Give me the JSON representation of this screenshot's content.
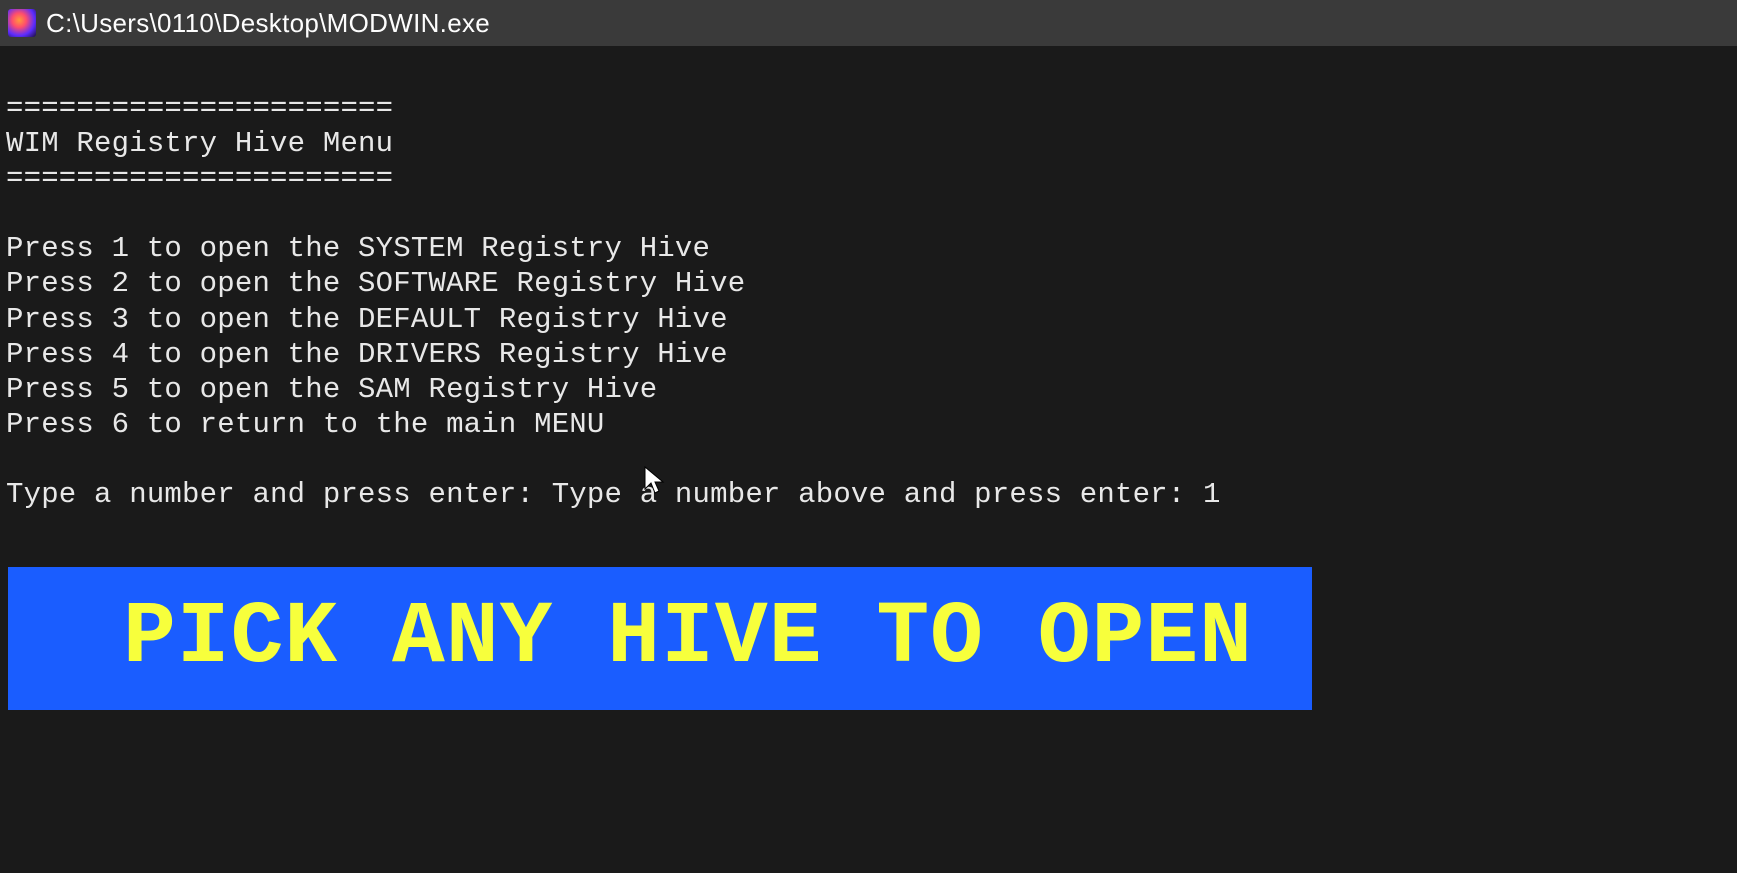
{
  "titlebar": {
    "path": "C:\\Users\\0110\\Desktop\\MODWIN.exe"
  },
  "terminal": {
    "divider_top": "======================",
    "heading": "WIM Registry Hive Menu",
    "divider_bottom": "======================",
    "options": [
      "Press 1 to open the SYSTEM Registry Hive",
      "Press 2 to open the SOFTWARE Registry Hive",
      "Press 3 to open the DEFAULT Registry Hive",
      "Press 4 to open the DRIVERS Registry Hive",
      "Press 5 to open the SAM Registry Hive",
      "Press 6 to return to the main MENU"
    ],
    "prompt_prefix": "Type a number and press enter: Type a number above and press enter: ",
    "input_value": "1"
  },
  "banner": {
    "text": "PICK ANY HIVE TO OPEN"
  }
}
